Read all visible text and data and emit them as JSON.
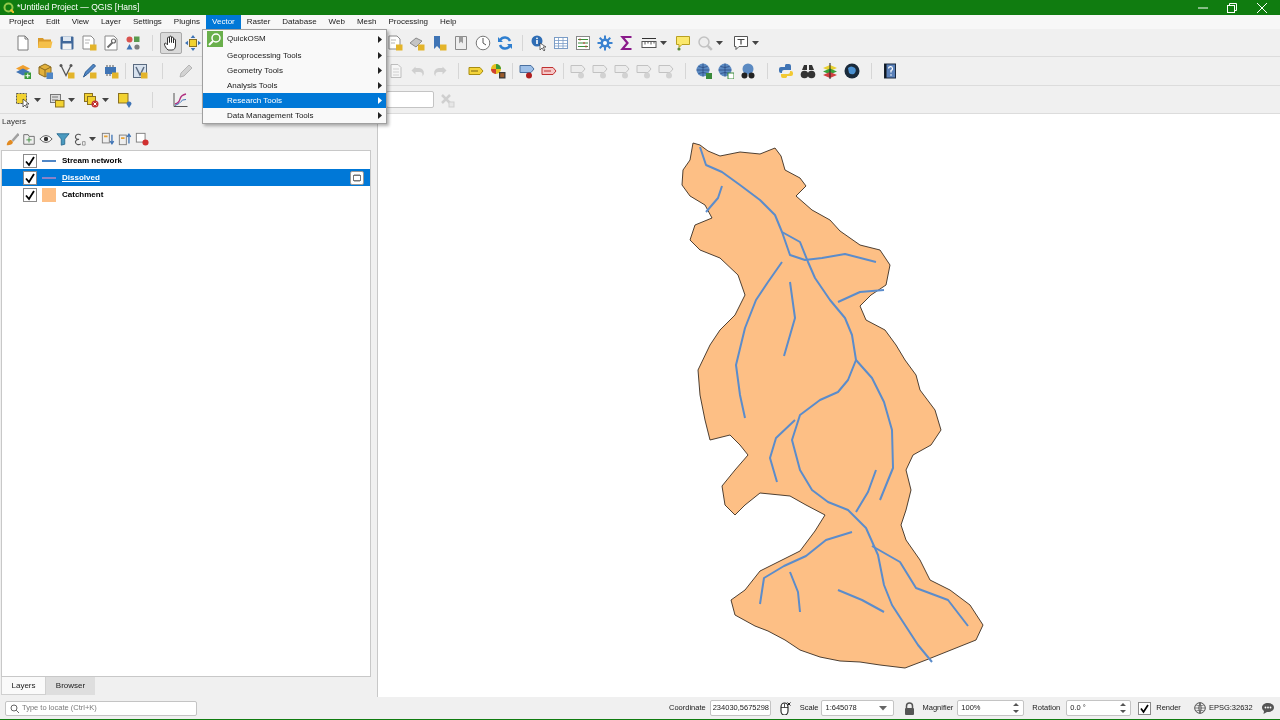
{
  "window": {
    "title": "*Untitled Project — QGIS [Hans]"
  },
  "menu_bar": [
    {
      "label": "Project",
      "selected": false
    },
    {
      "label": "Edit",
      "selected": false
    },
    {
      "label": "View",
      "selected": false
    },
    {
      "label": "Layer",
      "selected": false
    },
    {
      "label": "Settings",
      "selected": false
    },
    {
      "label": "Plugins",
      "selected": false
    },
    {
      "label": "Vector",
      "selected": true
    },
    {
      "label": "Raster",
      "selected": false
    },
    {
      "label": "Database",
      "selected": false
    },
    {
      "label": "Web",
      "selected": false
    },
    {
      "label": "Mesh",
      "selected": false
    },
    {
      "label": "Processing",
      "selected": false
    },
    {
      "label": "Help",
      "selected": false
    }
  ],
  "vector_menu": [
    {
      "label": "QuickOSM",
      "kind": "plugin",
      "selected": false,
      "submenu": true
    },
    {
      "label": "Geoprocessing Tools",
      "kind": "tools",
      "selected": false,
      "submenu": true
    },
    {
      "label": "Geometry Tools",
      "kind": "tools",
      "selected": false,
      "submenu": true
    },
    {
      "label": "Analysis Tools",
      "kind": "tools",
      "selected": false,
      "submenu": true
    },
    {
      "label": "Research Tools",
      "kind": "tools",
      "selected": true,
      "submenu": true
    },
    {
      "label": "Data Management Tools",
      "kind": "tools",
      "selected": false,
      "submenu": true
    }
  ],
  "toolbar": {
    "pan_tool": {
      "selected": true
    }
  },
  "layers_panel": {
    "title": "Layers",
    "layers": [
      {
        "name": "Stream network",
        "checked": true,
        "selected": false,
        "kind": "line",
        "color": "#4f86c6",
        "temporary": false
      },
      {
        "name": "Dissolved",
        "checked": true,
        "selected": true,
        "kind": "line",
        "color": "#8a82c8",
        "temporary": true
      },
      {
        "name": "Catchment",
        "checked": true,
        "selected": false,
        "kind": "fill",
        "color": "#fdbf85",
        "temporary": false
      }
    ],
    "tabs": [
      {
        "label": "Layers",
        "selected": true
      },
      {
        "label": "Browser",
        "selected": false
      }
    ]
  },
  "locator": {
    "placeholder": "Type to locate (Ctrl+K)"
  },
  "status_bar": {
    "coordinate_label": "Coordinate",
    "coordinate": "234030,5675298",
    "scale_label": "Scale",
    "scale": "1:645078",
    "magnifier_label": "Magnifier",
    "magnifier": "100%",
    "rotation_label": "Rotation",
    "rotation": "0.0 °",
    "render": {
      "label": "Render",
      "checked": true
    },
    "crs": "EPSG:32632"
  }
}
